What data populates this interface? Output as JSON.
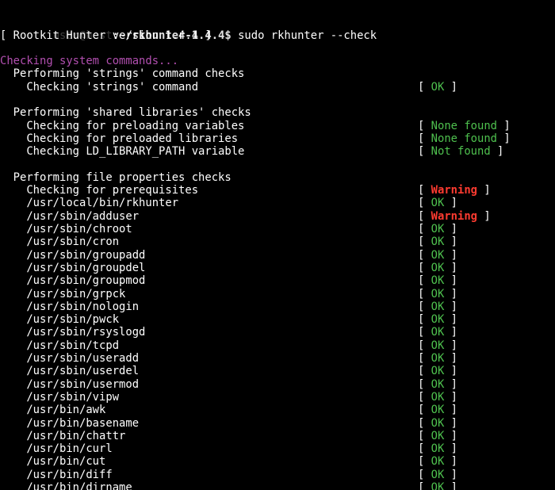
{
  "prompt": {
    "user_host": "user@host",
    "path": ":~/rkhunter-1.4.4$",
    "command": " sudo rkhunter --check"
  },
  "version_line": "[ Rootkit Hunter version 1.4.4 ]",
  "section_header": "Checking system commands...",
  "groups": [
    {
      "title": "  Performing 'strings' command checks",
      "items": [
        {
          "label": "    Checking 'strings' command",
          "status": "OK",
          "kind": "ok"
        }
      ]
    },
    {
      "title": "  Performing 'shared libraries' checks",
      "items": [
        {
          "label": "    Checking for preloading variables",
          "status": "None found",
          "kind": "none"
        },
        {
          "label": "    Checking for preloaded libraries",
          "status": "None found",
          "kind": "none"
        },
        {
          "label": "    Checking LD_LIBRARY_PATH variable",
          "status": "Not found",
          "kind": "none"
        }
      ]
    },
    {
      "title": "  Performing file properties checks",
      "items": [
        {
          "label": "    Checking for prerequisites",
          "status": "Warning",
          "kind": "warn"
        },
        {
          "label": "    /usr/local/bin/rkhunter",
          "status": "OK",
          "kind": "ok"
        },
        {
          "label": "    /usr/sbin/adduser",
          "status": "Warning",
          "kind": "warn"
        },
        {
          "label": "    /usr/sbin/chroot",
          "status": "OK",
          "kind": "ok"
        },
        {
          "label": "    /usr/sbin/cron",
          "status": "OK",
          "kind": "ok"
        },
        {
          "label": "    /usr/sbin/groupadd",
          "status": "OK",
          "kind": "ok"
        },
        {
          "label": "    /usr/sbin/groupdel",
          "status": "OK",
          "kind": "ok"
        },
        {
          "label": "    /usr/sbin/groupmod",
          "status": "OK",
          "kind": "ok"
        },
        {
          "label": "    /usr/sbin/grpck",
          "status": "OK",
          "kind": "ok"
        },
        {
          "label": "    /usr/sbin/nologin",
          "status": "OK",
          "kind": "ok"
        },
        {
          "label": "    /usr/sbin/pwck",
          "status": "OK",
          "kind": "ok"
        },
        {
          "label": "    /usr/sbin/rsyslogd",
          "status": "OK",
          "kind": "ok"
        },
        {
          "label": "    /usr/sbin/tcpd",
          "status": "OK",
          "kind": "ok"
        },
        {
          "label": "    /usr/sbin/useradd",
          "status": "OK",
          "kind": "ok"
        },
        {
          "label": "    /usr/sbin/userdel",
          "status": "OK",
          "kind": "ok"
        },
        {
          "label": "    /usr/sbin/usermod",
          "status": "OK",
          "kind": "ok"
        },
        {
          "label": "    /usr/sbin/vipw",
          "status": "OK",
          "kind": "ok"
        },
        {
          "label": "    /usr/bin/awk",
          "status": "OK",
          "kind": "ok"
        },
        {
          "label": "    /usr/bin/basename",
          "status": "OK",
          "kind": "ok"
        },
        {
          "label": "    /usr/bin/chattr",
          "status": "OK",
          "kind": "ok"
        },
        {
          "label": "    /usr/bin/curl",
          "status": "OK",
          "kind": "ok"
        },
        {
          "label": "    /usr/bin/cut",
          "status": "OK",
          "kind": "ok"
        },
        {
          "label": "    /usr/bin/diff",
          "status": "OK",
          "kind": "ok"
        },
        {
          "label": "    /usr/bin/dirname",
          "status": "OK",
          "kind": "ok"
        }
      ]
    }
  ],
  "colors": {
    "background": "#000000",
    "text": "#ffffff",
    "section": "#b24fb0",
    "ok": "#4ec04e",
    "warning": "#ff3b30"
  }
}
